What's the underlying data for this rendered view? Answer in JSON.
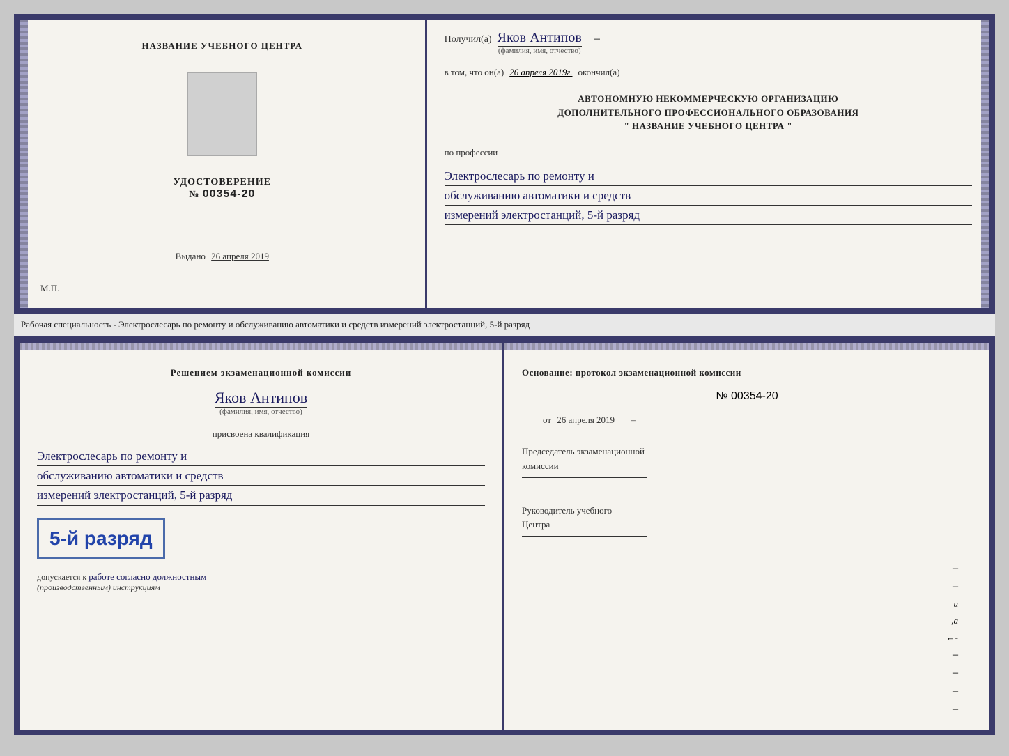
{
  "doc": {
    "top": {
      "left": {
        "center_header": "НАЗВАНИЕ УЧЕБНОГО ЦЕНТРА",
        "cert_title": "УДОСТОВЕРЕНИЕ",
        "cert_number_prefix": "№",
        "cert_number": "00354-20",
        "issued_label": "Выдано",
        "issued_date": "26 апреля 2019",
        "mp_label": "М.П."
      },
      "right": {
        "received_label": "Получил(а)",
        "recipient_name": "Яков Антипов",
        "fio_label": "(фамилия, имя, отчество)",
        "in_that_prefix": "в том, что он(а)",
        "in_that_date": "26 апреля 2019г.",
        "finished_label": "окончил(а)",
        "org_line1": "АВТОНОМНУЮ НЕКОММЕРЧЕСКУЮ ОРГАНИЗАЦИЮ",
        "org_line2": "ДОПОЛНИТЕЛЬНОГО ПРОФЕССИОНАЛЬНОГО ОБРАЗОВАНИЯ",
        "org_line3": "\"  НАЗВАНИЕ УЧЕБНОГО ЦЕНТРА  \"",
        "profession_label": "по профессии",
        "profession_line1": "Электрослесарь по ремонту и",
        "profession_line2": "обслуживанию автоматики и средств",
        "profession_line3": "измерений электростанций, 5-й разряд"
      }
    },
    "specialty_text": "Рабочая специальность - Электрослесарь по ремонту и обслуживанию автоматики и средств измерений электростанций, 5-й разряд",
    "bottom": {
      "left": {
        "decision_line": "Решением  экзаменационной  комиссии",
        "name": "Яков Антипов",
        "fio_label": "(фамилия, имя, отчество)",
        "assigned_label": "присвоена квалификация",
        "qualification_line1": "Электрослесарь по ремонту и",
        "qualification_line2": "обслуживанию автоматики и средств",
        "qualification_line3": "измерений электростанций, 5-й разряд",
        "grade": "5-й разряд",
        "admission_prefix": "допускается к",
        "admission_text": "работе согласно должностным",
        "admission_text2": "(производственным) инструкциям"
      },
      "right": {
        "basis_label": "Основание: протокол экзаменационной  комиссии",
        "number_prefix": "№",
        "number": "00354-20",
        "date_prefix": "от",
        "date": "26 апреля 2019",
        "chairman_label": "Председатель экзаменационной",
        "chairman_label2": "комиссии",
        "head_label": "Руководитель учебного",
        "head_label2": "Центра"
      }
    }
  }
}
